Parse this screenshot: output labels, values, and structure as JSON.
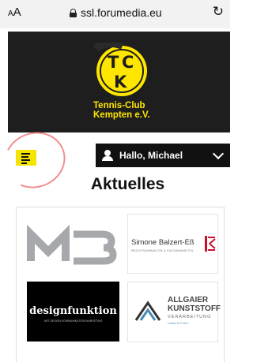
{
  "browser": {
    "text_size_label": "AA",
    "url": "ssl.forumedia.eu",
    "reload_icon": "reload-icon"
  },
  "header": {
    "club_name_line1": "Tennis-Club",
    "club_name_line2": "Kempten e.V.",
    "logo_letters": "TCK",
    "brand_color": "#ffe600"
  },
  "nav": {
    "menu_icon": "menu-icon",
    "user_greeting": "Hallo, Michael"
  },
  "main": {
    "heading": "Aktuelles",
    "sponsors": [
      {
        "name": "MB"
      },
      {
        "name": "Simone Balzert-Eß",
        "subtitle": "RECHTSANWÄLTIN & FACHANWÄLTIN"
      },
      {
        "name": "designfunktion",
        "subtitle": "ART DESIGN KOMMUNIKATION MARKETING"
      },
      {
        "name_line1": "ALLGAIER",
        "name_line2": "KUNSTSTOFF",
        "tagline": "VERARBEITUNG",
        "slogan": "Lösen in Form."
      }
    ]
  }
}
